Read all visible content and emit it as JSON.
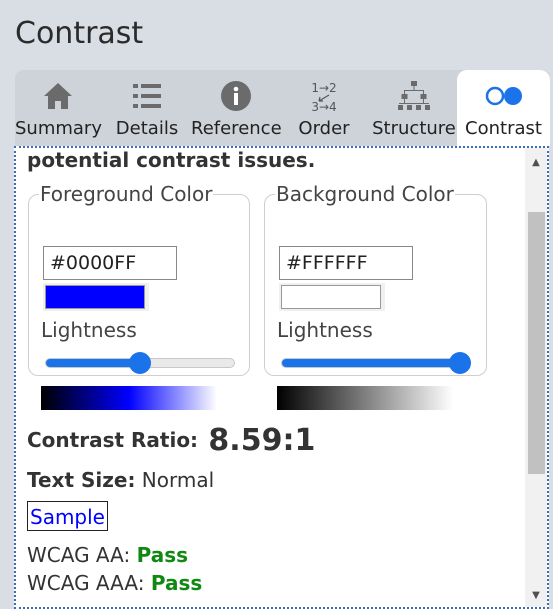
{
  "panel": {
    "title": "Contrast"
  },
  "tabs": [
    {
      "label": "Summary",
      "icon": "home-icon"
    },
    {
      "label": "Details",
      "icon": "list-icon"
    },
    {
      "label": "Reference",
      "icon": "info-icon"
    },
    {
      "label": "Order",
      "icon": "order-icon",
      "icon_text_top": "1→2",
      "icon_text_bottom": "3→4"
    },
    {
      "label": "Structure",
      "icon": "structure-icon"
    },
    {
      "label": "Contrast",
      "icon": "contrast-icon",
      "active": true
    }
  ],
  "intro_text": "potential contrast issues.",
  "foreground": {
    "legend": "Foreground Color",
    "hex": "#0000FF",
    "lightness_label": "Lightness",
    "lightness": 0.5,
    "swatch_color": "#0000ff"
  },
  "background": {
    "legend": "Background Color",
    "hex": "#FFFFFF",
    "lightness_label": "Lightness",
    "lightness": 1.0,
    "swatch_color": "#ffffff"
  },
  "results": {
    "ratio_label": "Contrast Ratio:",
    "ratio_value": "8.59:1",
    "text_size_label": "Text Size:",
    "text_size_value": "Normal",
    "sample_text": "Sample",
    "wcag_aa_label": "WCAG AA:",
    "wcag_aa_value": "Pass",
    "wcag_aaa_label": "WCAG AAA:",
    "wcag_aaa_value": "Pass"
  },
  "colors": {
    "accent": "#1a73e8",
    "pass": "#118811",
    "focus_border": "#3a6db5"
  }
}
